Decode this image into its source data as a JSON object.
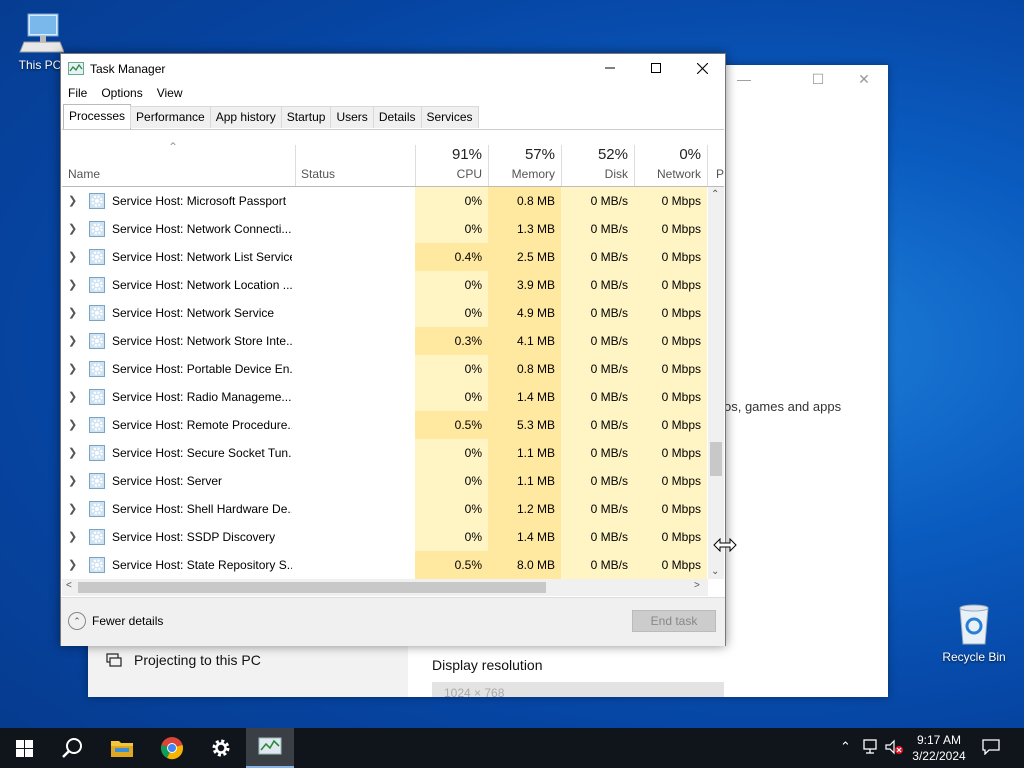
{
  "desktop": {
    "this_pc_label": "This PC",
    "recycle_bin_label": "Recycle Bin"
  },
  "settings_window": {
    "projecting_label": "Projecting to this PC",
    "partial_text": "os, games and apps",
    "display_resolution_label": "Display resolution",
    "display_resolution_value": "1024 × 768",
    "minimize_glyph": "—",
    "maximize_glyph": "☐",
    "close_glyph": "✕"
  },
  "task_manager": {
    "title": "Task Manager",
    "menu": [
      "File",
      "Options",
      "View"
    ],
    "tabs": [
      "Processes",
      "Performance",
      "App history",
      "Startup",
      "Users",
      "Details",
      "Services"
    ],
    "active_tab": "Processes",
    "columns": {
      "name": "Name",
      "status": "Status",
      "cpu": {
        "label": "CPU",
        "percent": "91%"
      },
      "memory": {
        "label": "Memory",
        "percent": "57%"
      },
      "disk": {
        "label": "Disk",
        "percent": "52%"
      },
      "network": {
        "label": "Network",
        "percent": "0%"
      },
      "power_partial": "P"
    },
    "rows": [
      {
        "name": "Service Host: Microsoft Passport",
        "cpu": "0%",
        "memory": "0.8 MB",
        "disk": "0 MB/s",
        "network": "0 Mbps"
      },
      {
        "name": "Service Host: Network Connecti...",
        "cpu": "0%",
        "memory": "1.3 MB",
        "disk": "0 MB/s",
        "network": "0 Mbps"
      },
      {
        "name": "Service Host: Network List Service",
        "cpu": "0.4%",
        "memory": "2.5 MB",
        "disk": "0 MB/s",
        "network": "0 Mbps"
      },
      {
        "name": "Service Host: Network Location ...",
        "cpu": "0%",
        "memory": "3.9 MB",
        "disk": "0 MB/s",
        "network": "0 Mbps"
      },
      {
        "name": "Service Host: Network Service",
        "cpu": "0%",
        "memory": "4.9 MB",
        "disk": "0 MB/s",
        "network": "0 Mbps"
      },
      {
        "name": "Service Host: Network Store Inte...",
        "cpu": "0.3%",
        "memory": "4.1 MB",
        "disk": "0 MB/s",
        "network": "0 Mbps"
      },
      {
        "name": "Service Host: Portable Device En...",
        "cpu": "0%",
        "memory": "0.8 MB",
        "disk": "0 MB/s",
        "network": "0 Mbps"
      },
      {
        "name": "Service Host: Radio Manageme...",
        "cpu": "0%",
        "memory": "1.4 MB",
        "disk": "0 MB/s",
        "network": "0 Mbps"
      },
      {
        "name": "Service Host: Remote Procedure...",
        "cpu": "0.5%",
        "memory": "5.3 MB",
        "disk": "0 MB/s",
        "network": "0 Mbps"
      },
      {
        "name": "Service Host: Secure Socket Tun...",
        "cpu": "0%",
        "memory": "1.1 MB",
        "disk": "0 MB/s",
        "network": "0 Mbps"
      },
      {
        "name": "Service Host: Server",
        "cpu": "0%",
        "memory": "1.1 MB",
        "disk": "0 MB/s",
        "network": "0 Mbps"
      },
      {
        "name": "Service Host: Shell Hardware De...",
        "cpu": "0%",
        "memory": "1.2 MB",
        "disk": "0 MB/s",
        "network": "0 Mbps"
      },
      {
        "name": "Service Host: SSDP Discovery",
        "cpu": "0%",
        "memory": "1.4 MB",
        "disk": "0 MB/s",
        "network": "0 Mbps"
      },
      {
        "name": "Service Host: State Repository S...",
        "cpu": "0.5%",
        "memory": "8.0 MB",
        "disk": "0 MB/s",
        "network": "0 Mbps"
      }
    ],
    "fewer_details_label": "Fewer details",
    "end_task_label": "End task"
  },
  "taskbar": {
    "time": "9:17 AM",
    "date": "3/22/2024"
  },
  "colors": {
    "highlight_light": "#fff4c4",
    "highlight_medium": "#ffe8a0",
    "taskbar": "#10151c"
  }
}
